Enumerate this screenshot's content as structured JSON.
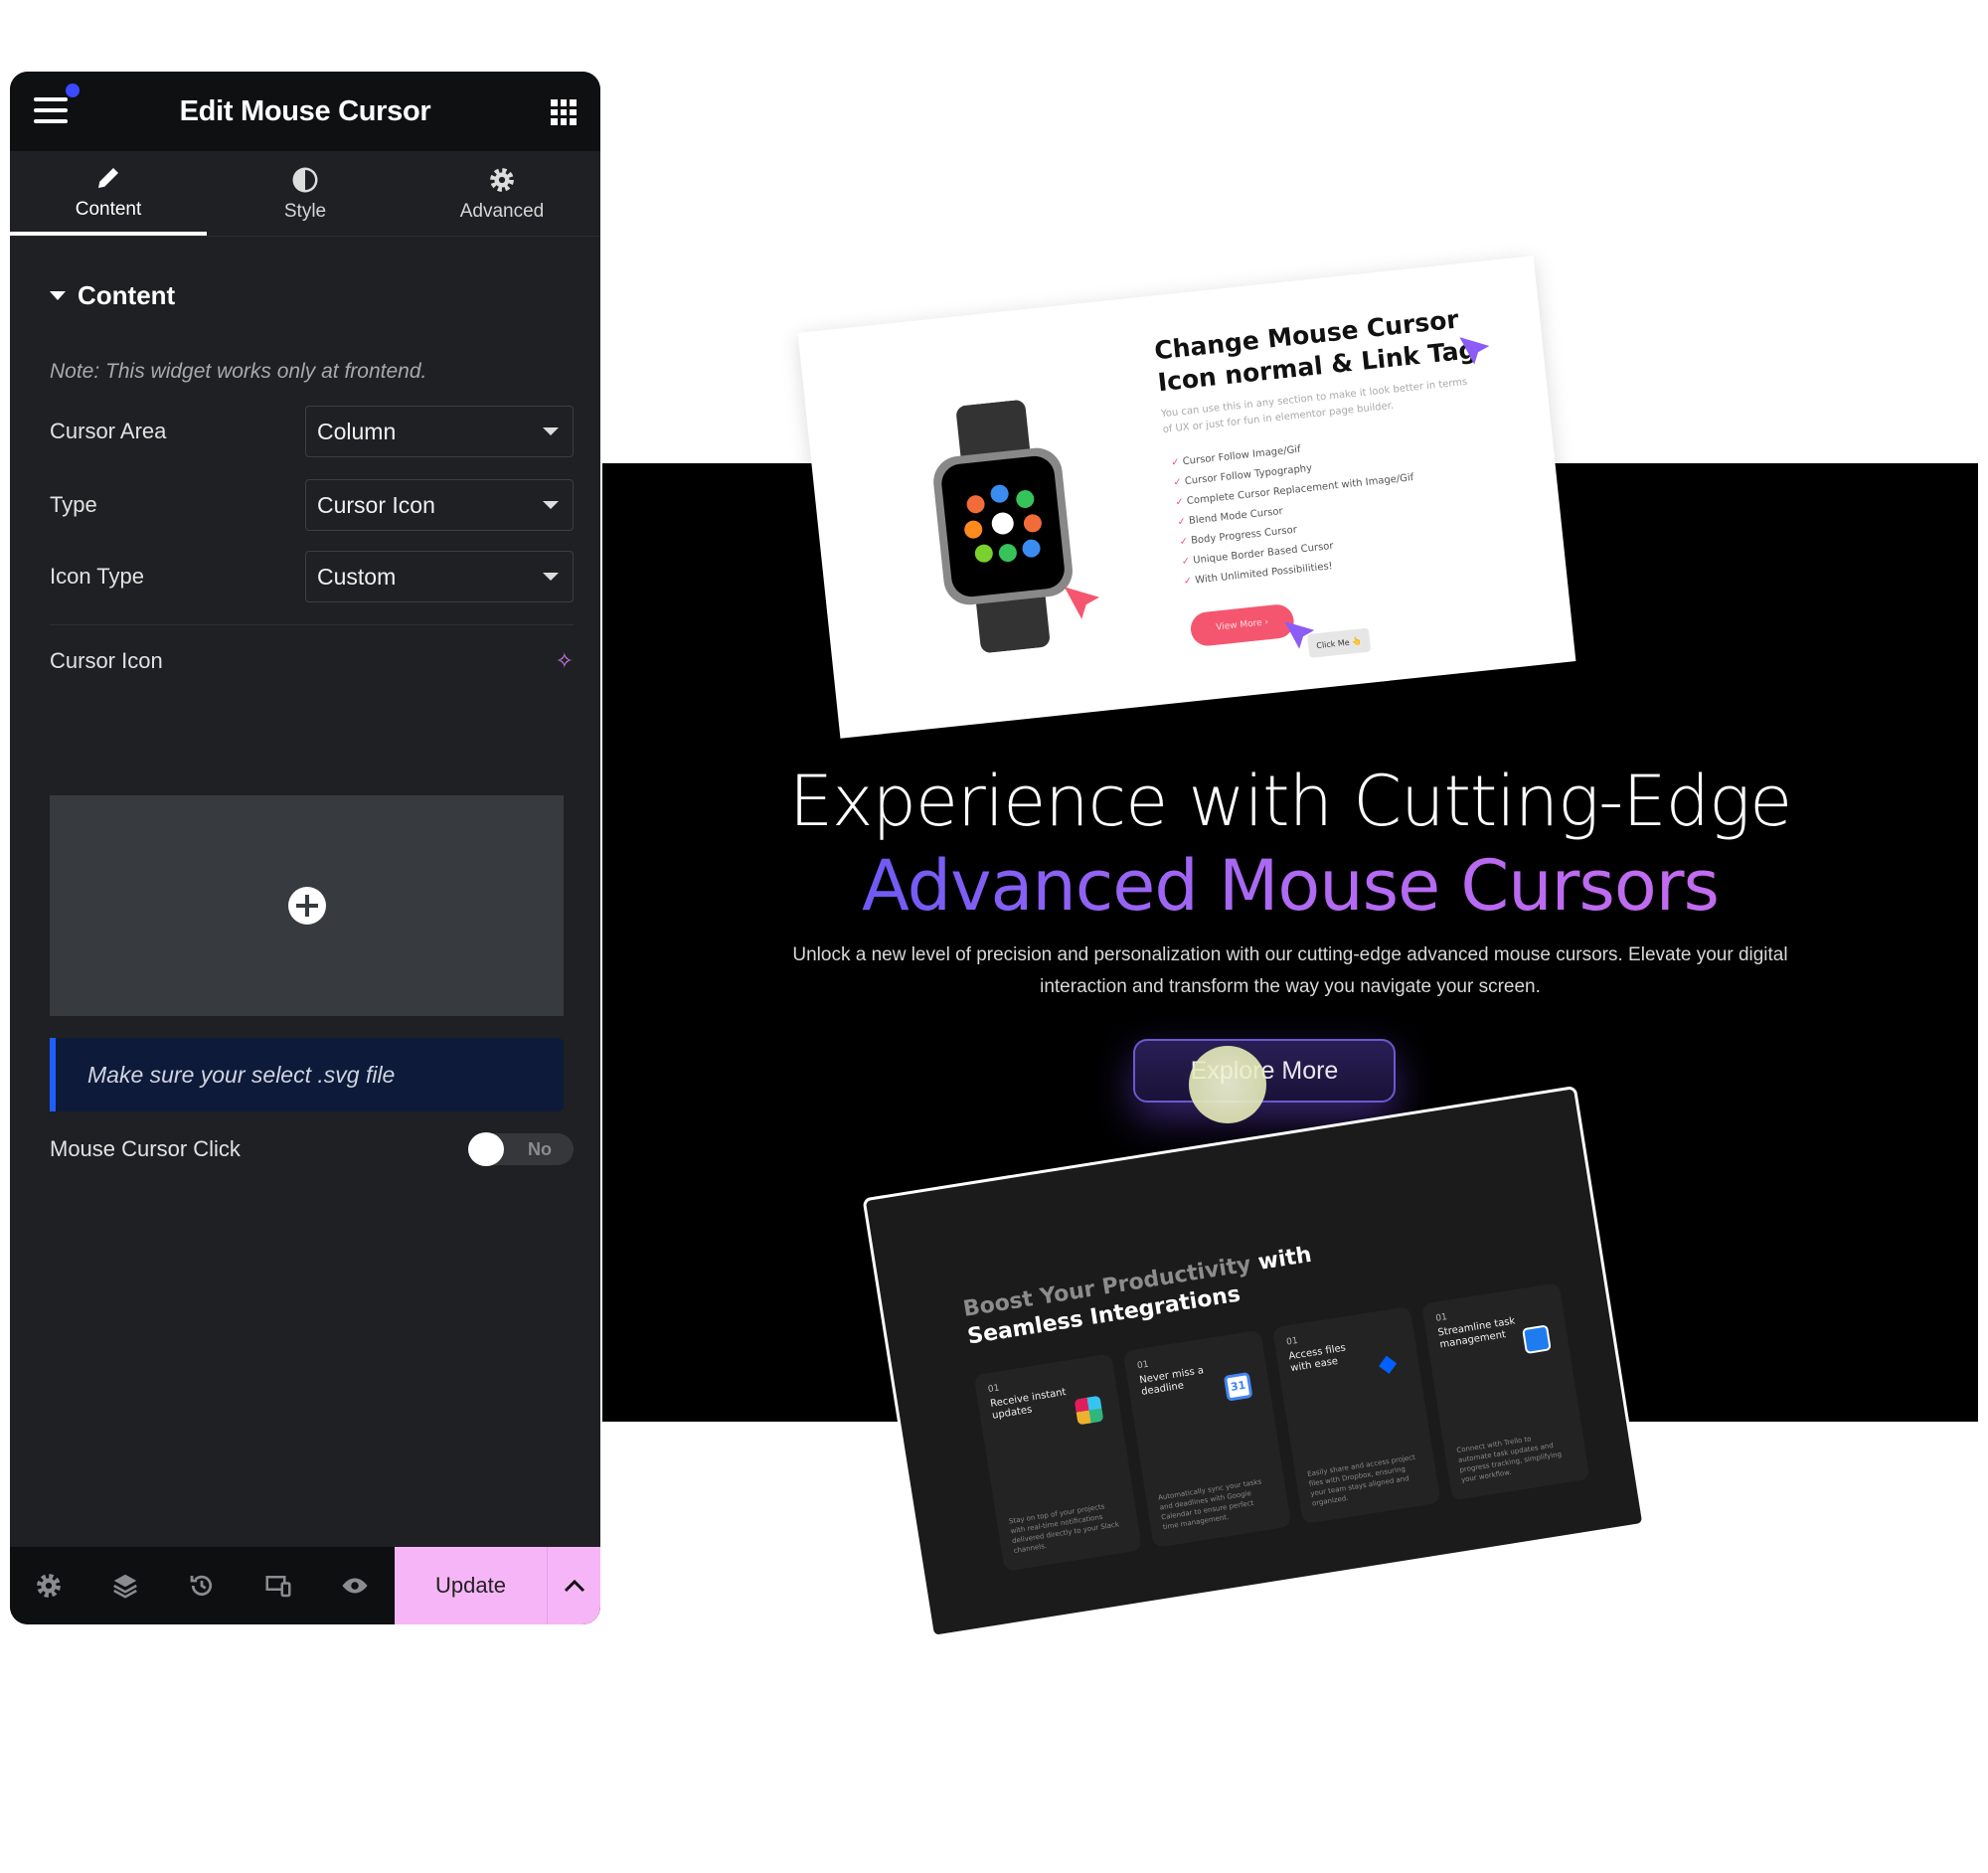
{
  "panel": {
    "title": "Edit Mouse Cursor",
    "tabs": [
      {
        "label": "Content",
        "icon": "pencil-icon",
        "active": true
      },
      {
        "label": "Style",
        "icon": "half-circle-icon"
      },
      {
        "label": "Advanced",
        "icon": "gear-icon"
      }
    ],
    "section_title": "Content",
    "note": "Note: This widget works only at frontend.",
    "fields": [
      {
        "label": "Cursor Area",
        "value": "Column"
      },
      {
        "label": "Type",
        "value": "Cursor Icon"
      },
      {
        "label": "Icon Type",
        "value": "Custom"
      }
    ],
    "cursor_icon_label": "Cursor Icon",
    "info": "Make sure your select .svg file",
    "click_label": "Mouse Cursor Click",
    "click_toggle": "No",
    "update_label": "Update",
    "accent": "#f6b5f7"
  },
  "preview": {
    "card1": {
      "title_line1": "Change Mouse Cursor",
      "title_line2": "Icon normal & Link Tag",
      "desc": "You can use this in any section to make it look better in terms of UX or just for fun in elementor page builder.",
      "features": [
        "Cursor Follow Image/Gif",
        "Cursor Follow Typography",
        "Complete Cursor Replacement with Image/Gif",
        "Blend Mode Cursor",
        "Body Progress Cursor",
        "Unique Border Based Cursor",
        "With Unlimited Possibilities!"
      ],
      "view_more": "View More  ›",
      "click_me": "Click Me 👆"
    },
    "hero_line1": "Experience with Cutting-Edge",
    "hero_line2": "Advanced Mouse Cursors",
    "lead": "Unlock a new level of precision and personalization with our cutting-edge advanced mouse cursors. Elevate your digital interaction and transform the way you navigate your screen.",
    "explore": "Explore More",
    "card2": {
      "title_grey": "Boost Your Productivity",
      "title_white1": " with",
      "title_white2": "Seamless Integrations",
      "items": [
        {
          "num": "01",
          "title": "Receive instant updates",
          "desc": "Stay on top of your projects with real-time notifications delivered directly to your Slack channels.",
          "icon": "slack-icon"
        },
        {
          "num": "01",
          "title": "Never miss a deadline",
          "desc": "Automatically sync your tasks and deadlines with Google Calendar to ensure perfect time management.",
          "icon": "google-calendar-icon"
        },
        {
          "num": "01",
          "title": "Access files with ease",
          "desc": "Easily share and access project files with Dropbox, ensuring your team stays aligned and organized.",
          "icon": "dropbox-icon"
        },
        {
          "num": "01",
          "title": "Streamline task management",
          "desc": "Connect with Trello to automate task updates and progress tracking, simplifying your workflow.",
          "icon": "trello-icon"
        }
      ]
    }
  }
}
